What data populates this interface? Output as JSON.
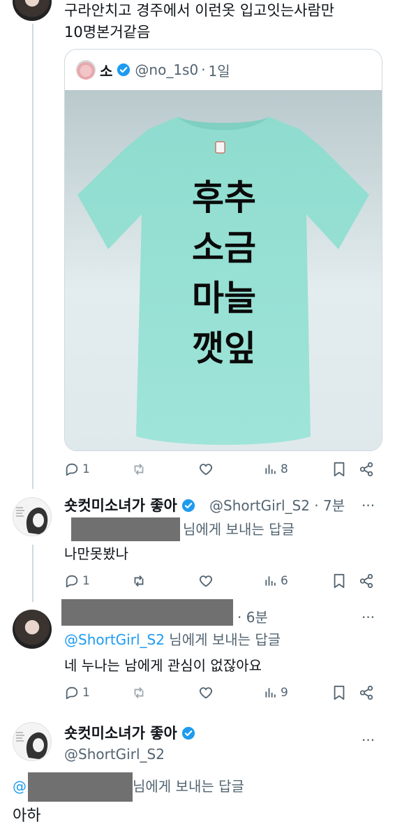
{
  "tweet1": {
    "text_line1": "구라안치고 경주에서 이런옷 입고잇는사람만",
    "text_line2": "10명본거같음",
    "quote": {
      "name": "소",
      "handle": "@no_1s0",
      "time": "1일",
      "shirt_lines": [
        "후추",
        "소금",
        "마늘",
        "깻잎"
      ]
    },
    "actions": {
      "replies": "1",
      "views": "8"
    }
  },
  "reply1": {
    "name": "숏컷미소녀가 좋아",
    "handle": "@ShortGirl_S2",
    "time": "· 7분",
    "reply_suffix": "님에게 보내는 답글",
    "text": "나만못봤나",
    "actions": {
      "replies": "1",
      "views": "6"
    }
  },
  "reply2": {
    "time": "· 6분",
    "reply_mention": "@ShortGirl_S2",
    "reply_suffix": "님에게 보내는 답글",
    "text": "네 누나는 남에게 관심이 없잖아요",
    "actions": {
      "replies": "1",
      "views": "9"
    }
  },
  "reply3": {
    "name": "숏컷미소녀가 좋아",
    "handle": "@ShortGirl_S2",
    "reply_mention_prefix": "@",
    "reply_suffix": "님에게 보내는 답글",
    "text": "아하"
  },
  "colors": {
    "accent": "#1d9bf0",
    "secondary": "#536471",
    "border": "#cfd9de",
    "shirt": "#96dfd3"
  },
  "more_label": "···"
}
